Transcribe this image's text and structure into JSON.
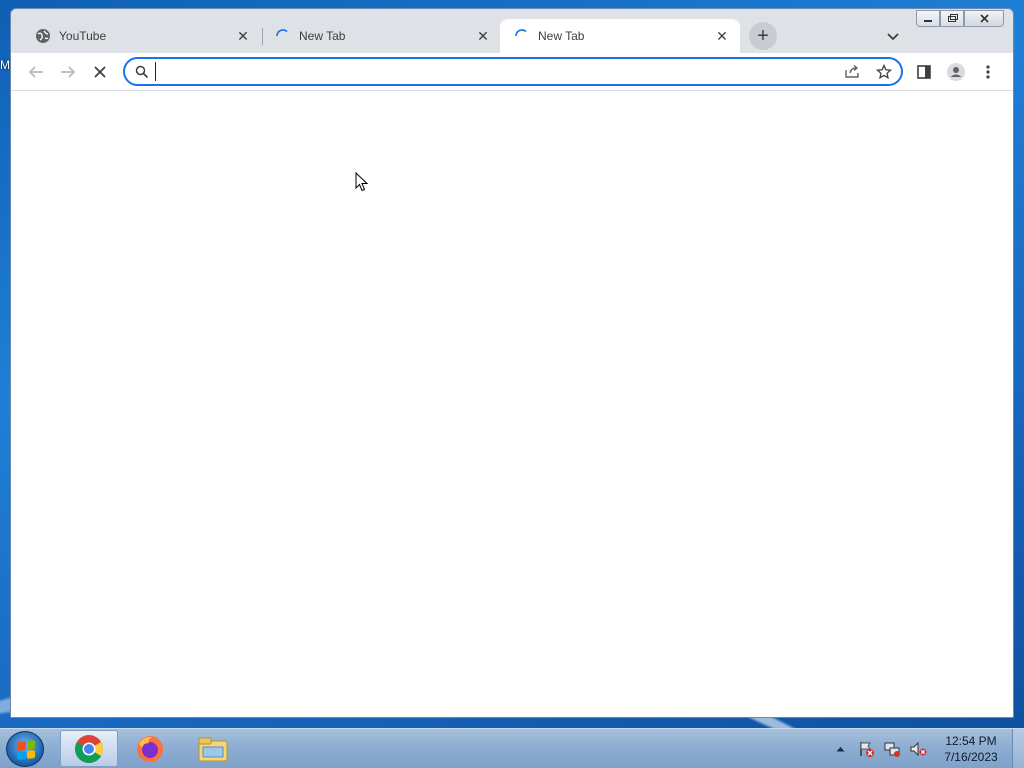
{
  "desktop": {
    "edge_letter": "M"
  },
  "browser": {
    "tabs": [
      {
        "title": "YouTube",
        "favicon": "globe-icon",
        "active": false
      },
      {
        "title": "New Tab",
        "favicon": "loading-spinner-icon",
        "active": false
      },
      {
        "title": "New Tab",
        "favicon": "loading-spinner-icon",
        "active": true
      }
    ],
    "tab_close_glyph": "✕",
    "new_tab_glyph": "+",
    "toolbar": {
      "back_icon": "arrow-left-icon",
      "forward_icon": "arrow-right-icon",
      "stop_icon": "close-icon",
      "address_value": "",
      "address_placeholder": "",
      "share_icon": "share-icon",
      "bookmark_icon": "star-icon",
      "side_panel_icon": "side-panel-icon",
      "profile_icon": "profile-icon",
      "menu_icon": "kebab-menu-icon"
    },
    "caption_buttons": [
      "minimize-icon",
      "restore-icon",
      "close-icon"
    ],
    "accent_color": "#1a73e8"
  },
  "taskbar": {
    "apps": [
      "chrome-icon",
      "firefox-icon",
      "file-explorer-icon"
    ],
    "active_app": "chrome-icon",
    "tray_icons": [
      "show-hidden-icons-arrow",
      "action-center-flag-icon",
      "network-icon",
      "volume-muted-icon"
    ],
    "clock": {
      "time": "12:54 PM",
      "date": "7/16/2023"
    }
  }
}
